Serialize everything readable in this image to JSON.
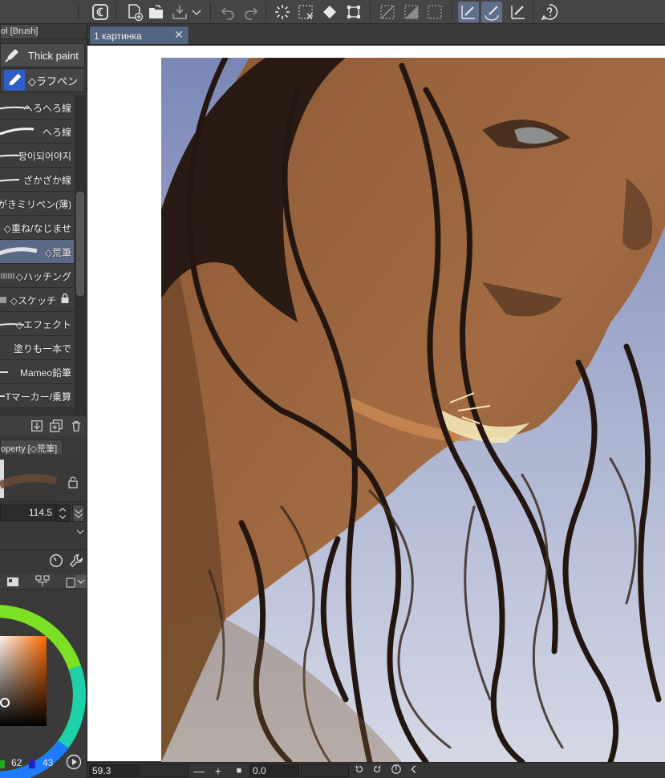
{
  "toolbar": {
    "icons": [
      "app-menu-icon",
      "new-file-icon",
      "open-folder-icon",
      "save-icon",
      "save-dropdown-icon",
      "undo-icon",
      "redo-icon",
      "loading-icon",
      "clear-selection-icon",
      "fill-icon",
      "transform-icon",
      "hide-selection-icon",
      "crop-icon",
      "select-all-icon",
      "snap-ruler-icon",
      "snap-special-ruler-icon",
      "snap-grid-icon",
      "help-icon"
    ]
  },
  "left_panel": {
    "tool_tab": "ol [Brush]",
    "groups": [
      {
        "label": "Thick paint",
        "icon": "paint-tube-icon"
      },
      {
        "label": "◇ラフペン",
        "icon": "pen-icon"
      }
    ],
    "brushes": [
      {
        "name": "へろへろ線",
        "selected": false
      },
      {
        "name": "へろ線",
        "selected": false
      },
      {
        "name": "팡이되어야지",
        "selected": false
      },
      {
        "name": "ざかざか線",
        "selected": false
      },
      {
        "name": "がきミリペン(薄)",
        "selected": false
      },
      {
        "name": "◇重ね/なじませ",
        "selected": false
      },
      {
        "name": "◇荒筆",
        "selected": true
      },
      {
        "name": "◇ハッチング",
        "selected": false
      },
      {
        "name": "◇スケッチ",
        "selected": false,
        "locked": true
      },
      {
        "name": "◇エフェクト",
        "selected": false
      },
      {
        "name": "塗りも一本で",
        "selected": false
      },
      {
        "name": "Mameo鉛筆",
        "selected": false
      },
      {
        "name": "Tマーカー/乗算",
        "selected": false
      }
    ],
    "property_tab": "operty [◇荒筆]",
    "brush_size": "114.5",
    "color": {
      "hue_ring": true,
      "square_color": "#c0621d",
      "values": [
        "62",
        "43"
      ]
    }
  },
  "document": {
    "tab_title": "1 картинка",
    "close_symbol": "✕"
  },
  "status": {
    "zoom": "59.3",
    "angle": "0.0",
    "minus": "—",
    "plus": "+",
    "stop": "■"
  },
  "colors": {
    "accent": "#5a6a86",
    "panel": "#3a3a3a",
    "canvas": "#ffffff"
  }
}
